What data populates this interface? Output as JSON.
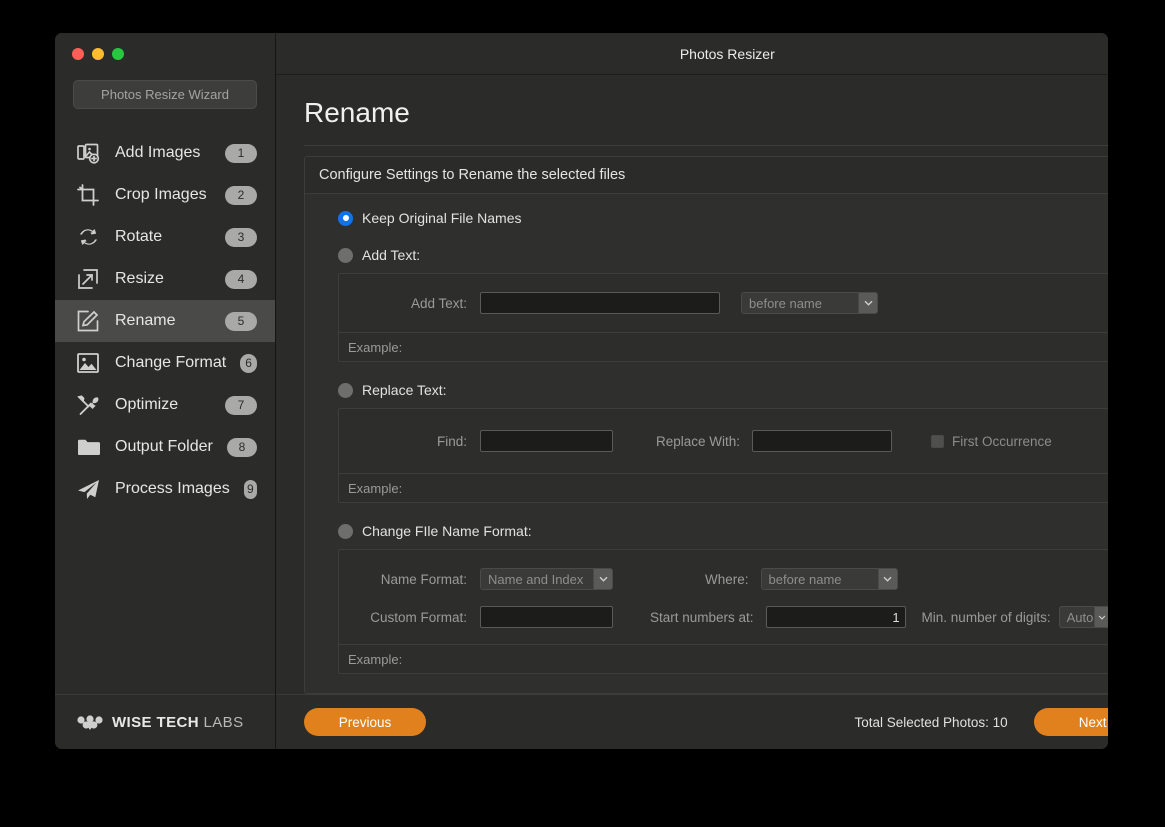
{
  "window": {
    "title": "Photos Resizer",
    "traffic_lights": [
      "close",
      "minimize",
      "zoom"
    ]
  },
  "sidebar": {
    "wizard_button": "Photos Resize Wizard",
    "items": [
      {
        "label": "Add Images",
        "badge": "1",
        "icon": "add-images-icon",
        "active": false
      },
      {
        "label": "Crop Images",
        "badge": "2",
        "icon": "crop-icon",
        "active": false
      },
      {
        "label": "Rotate",
        "badge": "3",
        "icon": "rotate-icon",
        "active": false
      },
      {
        "label": "Resize",
        "badge": "4",
        "icon": "resize-icon",
        "active": false
      },
      {
        "label": "Rename",
        "badge": "5",
        "icon": "rename-icon",
        "active": true
      },
      {
        "label": "Change Format",
        "badge": "6",
        "icon": "image-icon",
        "active": false
      },
      {
        "label": "Optimize",
        "badge": "7",
        "icon": "tools-icon",
        "active": false
      },
      {
        "label": "Output Folder",
        "badge": "8",
        "icon": "folder-icon",
        "active": false
      },
      {
        "label": "Process Images",
        "badge": "9",
        "icon": "paper-plane-icon",
        "active": false
      }
    ],
    "brand": {
      "bold": "WISE TECH",
      "light": "LABS"
    }
  },
  "page": {
    "title": "Rename",
    "panel_header": "Configure Settings to Rename the selected files"
  },
  "options": {
    "keep_original": {
      "label": "Keep Original File Names",
      "selected": true
    },
    "add_text": {
      "label": "Add Text:",
      "selected": false,
      "field_label": "Add Text:",
      "field_value": "",
      "field_placeholder": "",
      "where_value": "before name",
      "example_label": "Example:"
    },
    "replace_text": {
      "label": "Replace Text:",
      "selected": false,
      "find_label": "Find:",
      "find_value": "",
      "replace_label": "Replace With:",
      "replace_value": "",
      "first_occurrence_label": "First Occurrence",
      "first_occurrence_checked": false,
      "example_label": "Example:"
    },
    "change_format": {
      "label": "Change FIle Name Format:",
      "selected": false,
      "name_format_label": "Name Format:",
      "name_format_value": "Name and Index",
      "where_label": "Where:",
      "where_value": "before name",
      "custom_format_label": "Custom Format:",
      "custom_format_value": "",
      "start_numbers_label": "Start numbers at:",
      "start_numbers_value": "1",
      "min_digits_label": "Min. number of digits:",
      "min_digits_value": "Auto",
      "example_label": "Example:"
    }
  },
  "footer": {
    "previous_label": "Previous",
    "next_label": "Next",
    "total_label": "Total Selected Photos: 10"
  },
  "colors": {
    "accent_orange": "#e0811d",
    "radio_blue": "#1273e8",
    "window_bg": "#2b2b29",
    "panel_bg": "#2f2f2d"
  }
}
